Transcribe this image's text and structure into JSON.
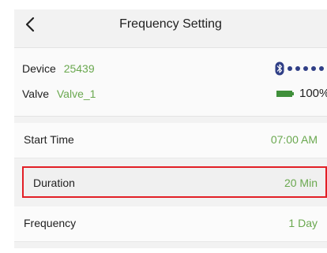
{
  "header": {
    "title": "Frequency Setting"
  },
  "device": {
    "device_label": "Device",
    "device_id": "25439",
    "valve_label": "Valve",
    "valve_name": "Valve_1",
    "battery": "100%",
    "signal_bars": 5
  },
  "settings": {
    "start_time_label": "Start Time",
    "start_time_value": "07:00 AM",
    "duration_label": "Duration",
    "duration_value": "20 Min",
    "frequency_label": "Frequency",
    "frequency_value": "1 Day"
  },
  "icons": {
    "back": "chevron-left-icon",
    "bluetooth": "bluetooth-icon",
    "battery": "battery-icon"
  },
  "colors": {
    "value_green": "#6aa84f",
    "highlight_red": "#e21f26",
    "signal_blue": "#2f3e86"
  }
}
